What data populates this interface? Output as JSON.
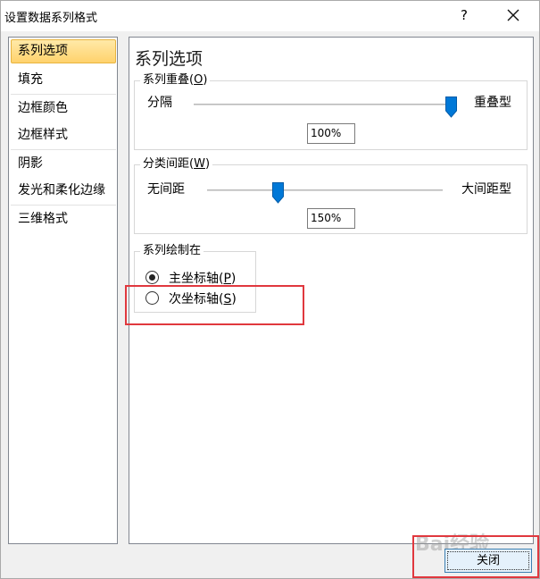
{
  "window": {
    "title": "设置数据系列格式",
    "help_label": "?"
  },
  "nav": {
    "items": [
      {
        "label": "系列选项",
        "selected": true
      },
      {
        "label": "填充"
      },
      {
        "label": "边框颜色"
      },
      {
        "label": "边框样式"
      },
      {
        "label": "阴影"
      },
      {
        "label": "发光和柔化边缘"
      },
      {
        "label": "三维格式"
      }
    ]
  },
  "panel": {
    "title": "系列选项",
    "overlap": {
      "label": "系列重叠",
      "hotkey": "O",
      "left_label": "分隔",
      "right_label": "重叠型",
      "value": "100%",
      "slider_fraction": 1.0
    },
    "gap": {
      "label": "分类间距",
      "hotkey": "W",
      "left_label": "无间距",
      "right_label": "大间距型",
      "value": "150%",
      "slider_fraction": 0.3
    },
    "plot_on": {
      "label": "系列绘制在",
      "options": [
        {
          "label": "主坐标轴",
          "hotkey": "P",
          "checked": true
        },
        {
          "label": "次坐标轴",
          "hotkey": "S",
          "checked": false
        }
      ]
    }
  },
  "footer": {
    "close_label": "关闭"
  },
  "watermark": {
    "text": "Bai经验"
  },
  "colors": {
    "accent": "#0078d7",
    "highlight": "#e0383e",
    "nav_selected": "#ffd26c"
  }
}
